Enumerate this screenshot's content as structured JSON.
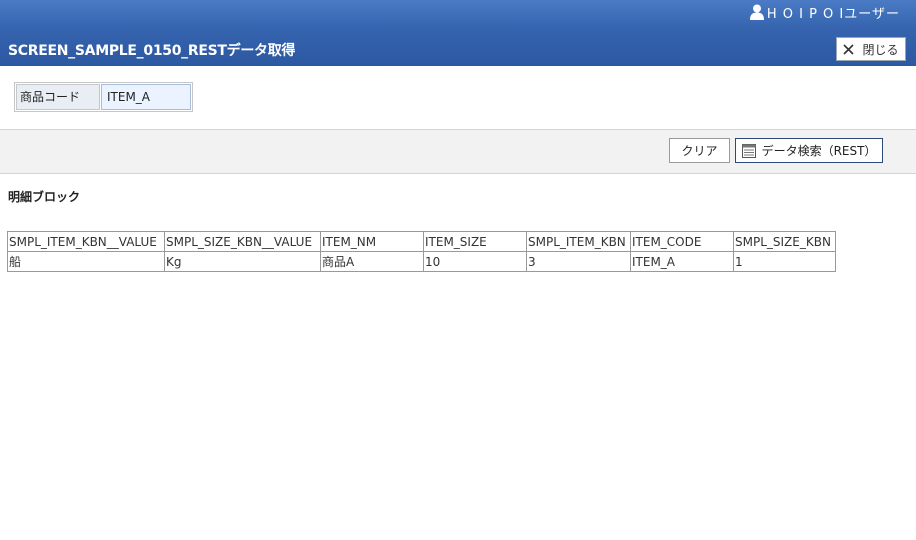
{
  "header": {
    "user_name": "H O I P O Iユーザー",
    "title": "SCREEN_SAMPLE_0150_RESTデータ取得",
    "close_label": "閉じる"
  },
  "condition": {
    "label": "商品コード",
    "value": "ITEM_A"
  },
  "toolbar": {
    "clear_label": "クリア",
    "search_label": "データ検索（REST）"
  },
  "detail": {
    "title": "明細ブロック",
    "columns": [
      "SMPL_ITEM_KBN__VALUE",
      "SMPL_SIZE_KBN__VALUE",
      "ITEM_NM",
      "ITEM_SIZE",
      "SMPL_ITEM_KBN",
      "ITEM_CODE",
      "SMPL_SIZE_KBN"
    ],
    "rows": [
      [
        "船",
        "Kg",
        "商品A",
        "10",
        "3",
        "ITEM_A",
        "1"
      ]
    ]
  }
}
